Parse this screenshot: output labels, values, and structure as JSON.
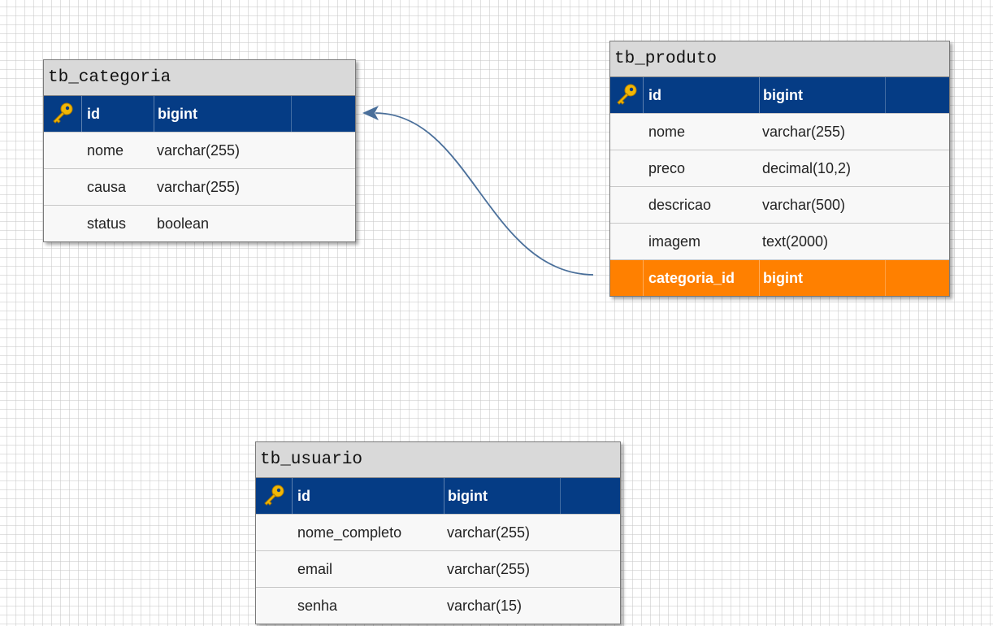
{
  "tables": {
    "categoria": {
      "name": "tb_categoria",
      "columns": [
        {
          "name": "id",
          "type": "bigint",
          "role": "pk"
        },
        {
          "name": "nome",
          "type": "varchar(255)"
        },
        {
          "name": "causa",
          "type": "varchar(255)"
        },
        {
          "name": "status",
          "type": "boolean"
        }
      ]
    },
    "produto": {
      "name": "tb_produto",
      "columns": [
        {
          "name": "id",
          "type": "bigint",
          "role": "pk"
        },
        {
          "name": "nome",
          "type": "varchar(255)"
        },
        {
          "name": "preco",
          "type": "decimal(10,2)"
        },
        {
          "name": "descricao",
          "type": "varchar(500)"
        },
        {
          "name": "imagem",
          "type": "text(2000)"
        },
        {
          "name": "categoria_id",
          "type": "bigint",
          "role": "fk"
        }
      ]
    },
    "usuario": {
      "name": "tb_usuario",
      "columns": [
        {
          "name": "id",
          "type": "bigint",
          "role": "pk"
        },
        {
          "name": "nome_completo",
          "type": "varchar(255)"
        },
        {
          "name": "email",
          "type": "varchar(255)"
        },
        {
          "name": "senha",
          "type": "varchar(15)"
        }
      ]
    }
  },
  "relationships": [
    {
      "from": "tb_produto.categoria_id",
      "to": "tb_categoria.id"
    }
  ],
  "colors": {
    "pk_row": "#053c85",
    "fk_row": "#ff8000",
    "header": "#d9d9d9",
    "relation_line": "#4a6f9a",
    "key_icon": "#f2b705"
  }
}
